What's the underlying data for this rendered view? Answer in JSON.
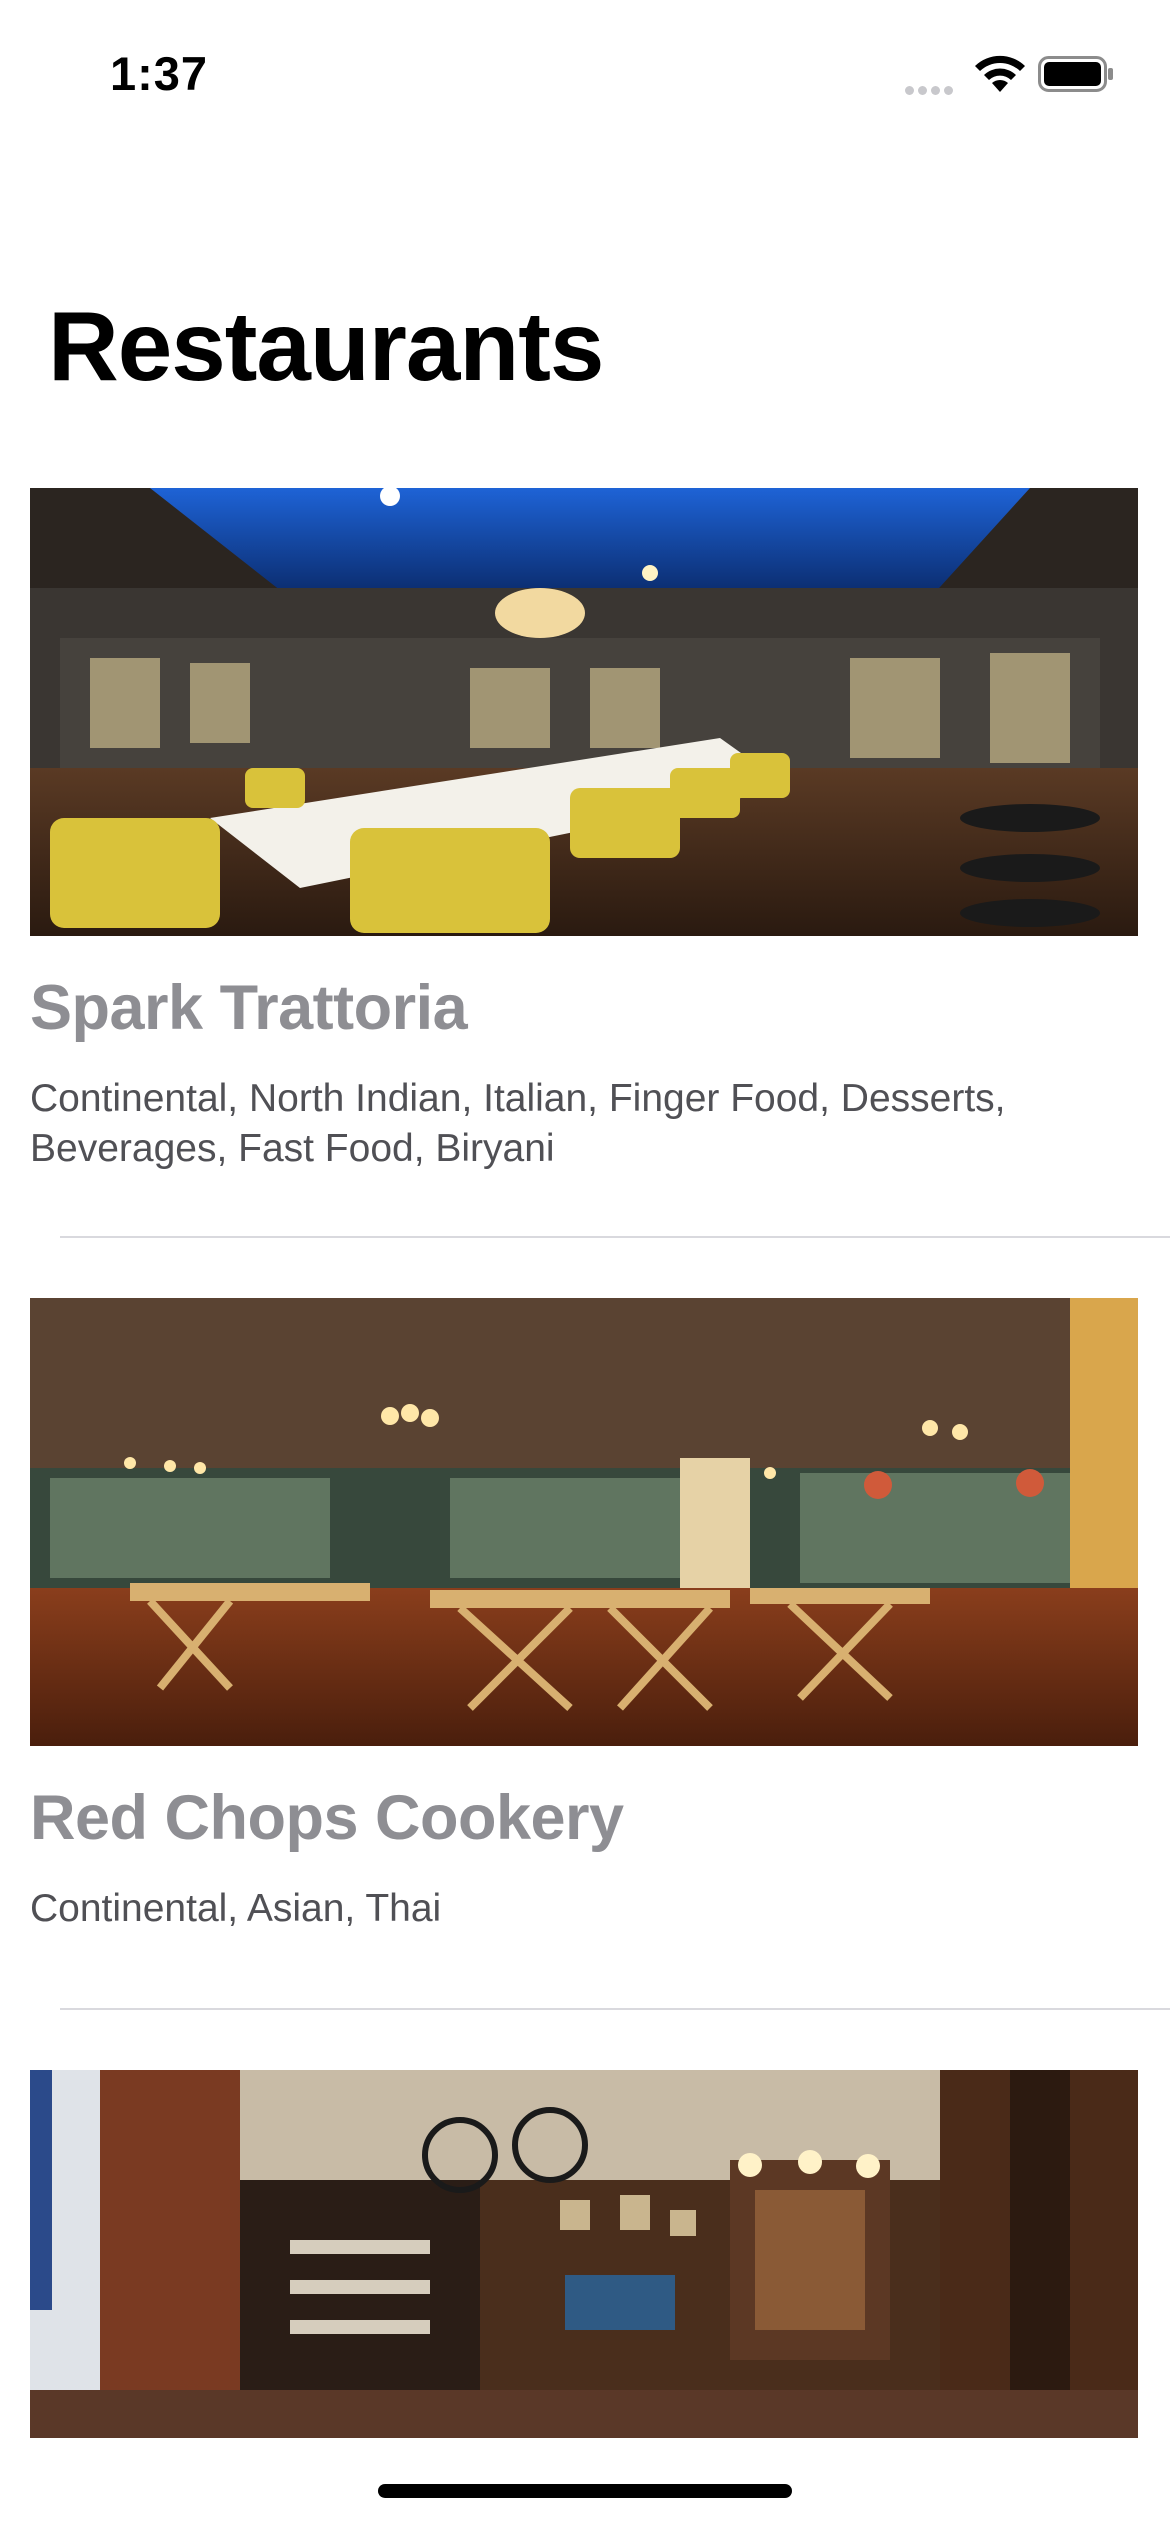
{
  "status_bar": {
    "time": "1:37"
  },
  "page": {
    "title": "Restaurants"
  },
  "restaurants": [
    {
      "name": "Spark Trattoria",
      "cuisines": "Continental, North Indian, Italian, Finger Food, Desserts, Beverages, Fast Food, Biryani",
      "photo_icon": "restaurant-photo-glass-roof-dining"
    },
    {
      "name": "Red Chops Cookery",
      "cuisines": "Continental, Asian, Thai",
      "photo_icon": "restaurant-photo-wooden-tables"
    },
    {
      "name": "",
      "cuisines": "",
      "photo_icon": "restaurant-photo-pub-interior"
    }
  ],
  "colors": {
    "title": "#000000",
    "restaurant_name": "#8e8e93",
    "cuisines": "#505055",
    "separator": "#d9d9de"
  }
}
